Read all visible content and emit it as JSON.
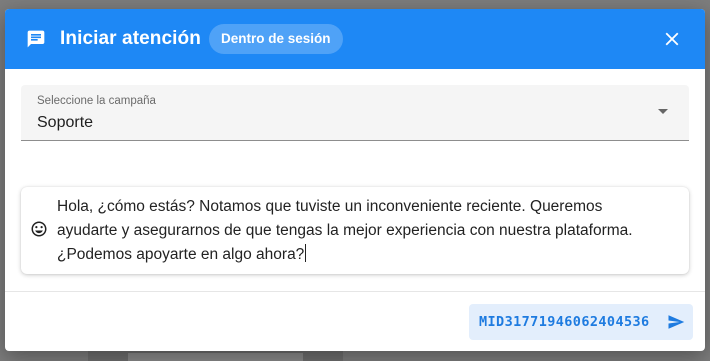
{
  "dialog": {
    "title": "Iniciar atención",
    "chip": "Dentro de sesión",
    "icons": {
      "header": "chat-icon",
      "close": "close-icon"
    }
  },
  "campaign": {
    "label": "Seleccione la campaña",
    "value": "Soporte"
  },
  "message": {
    "line1": "Hola, ¿cómo estás? Notamos que tuviste un inconveniente reciente. Queremos",
    "line2": "ayudarte y asegurarnos de que tengas la mejor experiencia con nuestra plataforma.",
    "line3": "¿Podemos apoyarte en algo ahora?",
    "icon": "emoji-icon"
  },
  "send": {
    "label": "MID31771946062404536",
    "icon": "send-icon"
  },
  "colors": {
    "header": "#1e88f5",
    "accent": "#1e7be0",
    "send_bg": "#e3eefc"
  }
}
